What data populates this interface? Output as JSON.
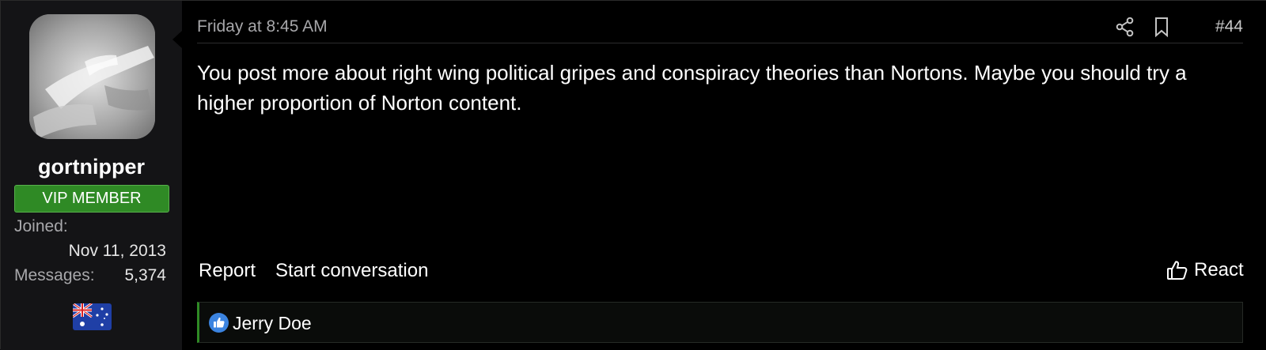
{
  "user": {
    "username": "gortnipper",
    "role": "VIP MEMBER",
    "joined_label": "Joined:",
    "joined_value": "Nov 11, 2013",
    "messages_label": "Messages:",
    "messages_value": "5,374",
    "flag": "australia-flag-icon"
  },
  "post": {
    "date": "Friday at 8:45 AM",
    "number": "#44",
    "share_icon": "share-icon",
    "bookmark_icon": "bookmark-icon",
    "message": "You post more about right wing political gripes and conspiracy theories than Nortons. Maybe you should try a higher proportion of Norton content."
  },
  "actions": {
    "report": "Report",
    "start_conversation": "Start conversation",
    "react": "React",
    "react_icon": "thumbs-up-outline-icon"
  },
  "reactions": {
    "icon": "like-icon",
    "names": "Jerry Doe"
  },
  "colors": {
    "badge_green": "#2f8a25",
    "like_blue": "#3b84e0"
  }
}
